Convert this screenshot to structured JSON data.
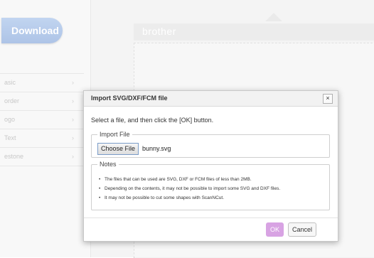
{
  "app": {
    "download_label": "Download",
    "brand": "brother",
    "menu": [
      "asic",
      "order",
      "ogo",
      "Text",
      "estone"
    ]
  },
  "dialog": {
    "title": "Import SVG/DXF/FCM file",
    "close_label": "×",
    "instruction": "Select a file, and then click the [OK] button.",
    "import_file": {
      "legend": "Import File",
      "choose_label": "Choose File",
      "filename": "bunny.svg"
    },
    "notes": {
      "legend": "Notes",
      "items": [
        "The files that can be used are SVG, DXF or FCM files of less than 2MB.",
        "Depending on the contents, it may not be possible to import some SVG and DXF files.",
        "It may not be possible to cut some shapes with ScanNCut."
      ]
    },
    "ok_label": "OK",
    "cancel_label": "Cancel"
  },
  "colors": {
    "accent": "#d8a3e3",
    "download": "#7aa1db"
  }
}
